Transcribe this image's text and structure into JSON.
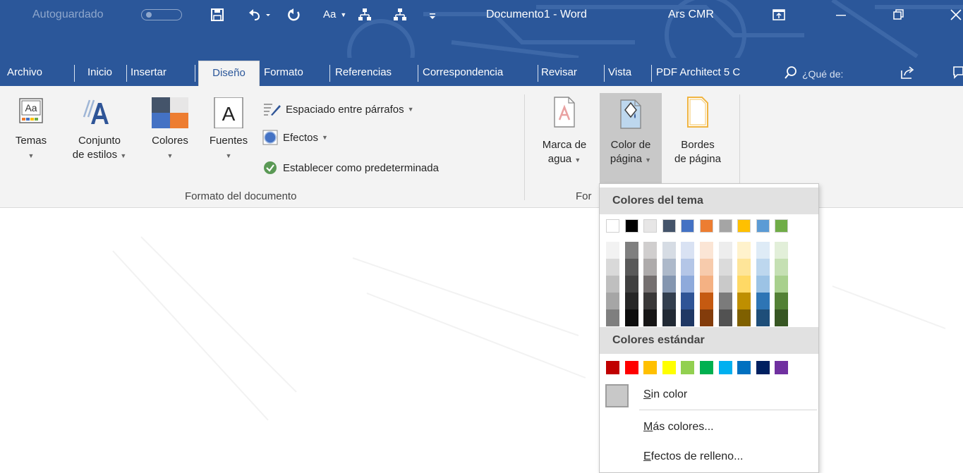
{
  "titlebar": {
    "autosave_label": "Autoguardado",
    "autosave_state": "off",
    "doc_title": "Documento1 - Word",
    "user_name": "Ars CMR",
    "qa_text": "Aa"
  },
  "tabs": [
    {
      "label": "Archivo",
      "active": false
    },
    {
      "label": "Inicio",
      "active": false
    },
    {
      "label": "Insertar",
      "active": false
    },
    {
      "label": "Diseño",
      "active": true
    },
    {
      "label": "Formato",
      "active": false
    },
    {
      "label": "Referencias",
      "active": false
    },
    {
      "label": "Correspondencia",
      "active": false
    },
    {
      "label": "Revisar",
      "active": false
    },
    {
      "label": "Vista",
      "active": false
    },
    {
      "label": "PDF Architect 5 C",
      "active": false
    }
  ],
  "search": {
    "placeholder": "¿Qué de:"
  },
  "ribbon": {
    "temas": "Temas",
    "conjunto_line1": "Conjunto",
    "conjunto_line2": "de estilos",
    "colores": "Colores",
    "fuentes": "Fuentes",
    "espaciado": "Espaciado entre párrafos",
    "efectos": "Efectos",
    "establecer": "Establecer como predeterminada",
    "group_formato": "Formato del documento",
    "marca_line1": "Marca de",
    "marca_line2": "agua",
    "color_line1": "Color de",
    "color_line2": "página",
    "bordes_line1": "Bordes",
    "bordes_line2": "de página",
    "group_fondo_partial": "For"
  },
  "dropdown": {
    "theme_header": "Colores del tema",
    "standard_header": "Colores estándar",
    "no_color": "Sin color",
    "more_colors": "Más colores...",
    "fill_effects": "Efectos de relleno...",
    "theme_colors": [
      "#ffffff",
      "#000000",
      "#e7e6e6",
      "#44546a",
      "#4472c4",
      "#ed7d31",
      "#a5a5a5",
      "#ffc000",
      "#5b9bd5",
      "#70ad47"
    ],
    "theme_shades": [
      [
        "#f2f2f2",
        "#d9d9d9",
        "#bfbfbf",
        "#a6a6a6",
        "#7f7f7f"
      ],
      [
        "#7f7f7f",
        "#595959",
        "#404040",
        "#262626",
        "#0d0d0d"
      ],
      [
        "#d0cece",
        "#aeabab",
        "#757070",
        "#3a3838",
        "#171616"
      ],
      [
        "#d6dce4",
        "#adb9ca",
        "#8496b0",
        "#333f4f",
        "#222a35"
      ],
      [
        "#d9e2f3",
        "#b4c6e7",
        "#8eaadb",
        "#2f5496",
        "#1f3864"
      ],
      [
        "#fbe5d5",
        "#f7cbac",
        "#f4b183",
        "#c55a11",
        "#833c0b"
      ],
      [
        "#ededed",
        "#dbdbdb",
        "#c9c9c9",
        "#7b7b7b",
        "#525252"
      ],
      [
        "#fff2cc",
        "#fee599",
        "#ffd965",
        "#bf8f00",
        "#7f6000"
      ],
      [
        "#deebf6",
        "#bdd7ee",
        "#9cc3e5",
        "#2e75b5",
        "#1e4e79"
      ],
      [
        "#e2efd9",
        "#c5e0b3",
        "#a8d08d",
        "#538135",
        "#375623"
      ]
    ],
    "standard_colors": [
      "#c00000",
      "#ff0000",
      "#ffc000",
      "#ffff00",
      "#92d050",
      "#00b050",
      "#00b0f0",
      "#0070c0",
      "#002060",
      "#7030a0"
    ],
    "no_color_swatch": "#c8c8c8"
  },
  "accent": "#2b579a"
}
